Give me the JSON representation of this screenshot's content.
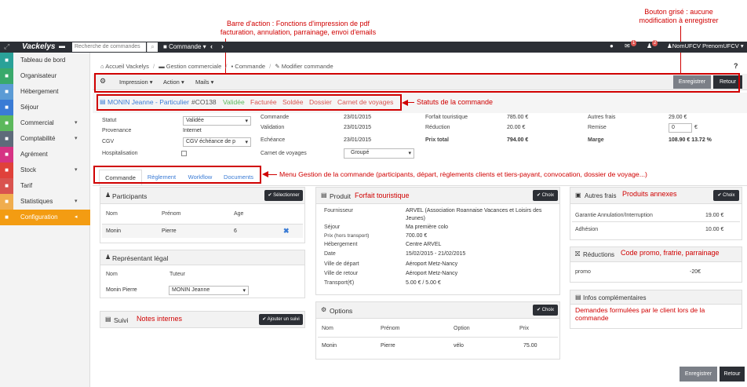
{
  "annotations": {
    "action_bar": [
      "Barre d'action : Fonctions d'impression de pdf",
      "facturation, annulation, parrainage, envoi d'emails"
    ],
    "grey_button": [
      "Bouton grisé : aucune",
      "modification à enregistrer"
    ],
    "statuses": "Statuts de la commande",
    "menu": "Menu Gestion de la commande (participants, départ, règlements clients et tiers-payant, convocation, dossier de voyage...)",
    "forfait": "Forfait touristique",
    "produits": "Produits annexes",
    "reductions": "Code promo, fratrie, parrainage",
    "notes": "Notes internes",
    "demandes": [
      "Demandes formulées par le client lors de la",
      "commande"
    ]
  },
  "topbar": {
    "logo": "Vackelys",
    "search_placeholder": "Recherche de commandes",
    "command": "Commande",
    "user": "NomUFCV PrenomUFCV",
    "badge_mail": "1",
    "badge_user": "2"
  },
  "sidebar": {
    "items": [
      {
        "label": "Tableau de bord",
        "color": "#2aa198"
      },
      {
        "label": "Organisateur",
        "color": "#39a96b"
      },
      {
        "label": "Hébergement",
        "color": "#5b9bd5"
      },
      {
        "label": "Séjour",
        "color": "#3a7bd5"
      },
      {
        "label": "Commercial",
        "color": "#5cb85c",
        "caret": "▾"
      },
      {
        "label": "Comptabilité",
        "color": "#5e6b7a",
        "caret": "▾"
      },
      {
        "label": "Agrément",
        "color": "#d63384"
      },
      {
        "label": "Stock",
        "color": "#e0413a",
        "caret": "▾"
      },
      {
        "label": "Tarif",
        "color": "#d9534f"
      },
      {
        "label": "Statistiques",
        "color": "#f0ad4e",
        "caret": "▾"
      },
      {
        "label": "Configuration",
        "color": "#f39c12",
        "caret": "◂",
        "active": true
      }
    ]
  },
  "breadcrumb": {
    "home": "Accueil Vackelys",
    "sep1": "/",
    "commercial": "Gestion commerciale",
    "sep2": "/",
    "commande": "Commande",
    "sep3": "/",
    "current": "Modifier commande"
  },
  "toolbar": {
    "impression": "Impression",
    "action": "Action",
    "mails": "Mails",
    "save": "Enregistrer",
    "back": "Retour"
  },
  "status_bar": {
    "client": "MONIN Jeanne",
    "type": "- Particulier",
    "code": "#CO138",
    "s1": "Validée",
    "s2": "Facturée",
    "s3": "Soldée",
    "s4": "Dossier",
    "s5": "Carnet de voyages"
  },
  "info": {
    "statut_label": "Statut",
    "statut_value": "Validée",
    "provenance_label": "Provenance",
    "provenance_value": "Internet",
    "cgv_label": "CGV",
    "cgv_value": "CGV échéance de p",
    "hosp_label": "Hospitalisation",
    "commande_label": "Commande",
    "commande_date": "23/01/2015",
    "validation_label": "Validation",
    "validation_date": "23/01/2015",
    "echeance_label": "Echéance",
    "echeance_date": "23/01/2015",
    "carnet_label": "Carnet de voyages",
    "carnet_value": "Groupé",
    "forfait_label": "Forfait touristique",
    "forfait_value": "785.00 €",
    "reduction_label": "Réduction",
    "reduction_value": "20.00 €",
    "prix_label": "Prix total",
    "prix_value": "794.00 €",
    "autres_label": "Autres frais",
    "autres_value": "29.00 €",
    "remise_label": "Remise",
    "remise_value": "0",
    "remise_unit": "€",
    "marge_label": "Marge",
    "marge_value": "108.90 € 13.72 %"
  },
  "tabs": [
    "Commande",
    "Règlement",
    "Workflow",
    "Documents"
  ],
  "participants": {
    "title": "Participants",
    "button": "Sélectionner",
    "headers": [
      "Nom",
      "Prénom",
      "Age"
    ],
    "row": [
      "Monin",
      "Pierre",
      "6"
    ]
  },
  "representant": {
    "title": "Représentant légal",
    "headers": [
      "Nom",
      "Tuteur"
    ],
    "row_name": "Monin Pierre",
    "tuteur": "MONIN Jeanne"
  },
  "suivi": {
    "title": "Suivi",
    "button": "Ajouter un suivi"
  },
  "produit": {
    "title": "Produit",
    "button": "Choix",
    "rows": [
      {
        "label": "Fournisseur",
        "value": "ARVEL (Association Roannaise Vacances et Loisirs des"
      },
      {
        "label": "",
        "value": "Jeunes)"
      },
      {
        "label": "Séjour",
        "value": "Ma première colo"
      },
      {
        "label": "Prix (hors transport)",
        "value": "700.00 €"
      },
      {
        "label": "Hébergement",
        "value": "Centre ARVEL"
      },
      {
        "label": "Date",
        "value": "15/02/2015 - 21/02/2015"
      },
      {
        "label": "Ville de départ",
        "value": "Aéroport Metz-Nancy"
      },
      {
        "label": "Ville de retour",
        "value": "Aéroport Metz-Nancy"
      },
      {
        "label": "Transport(€)",
        "value": "5.00 €  /  5.00 €"
      }
    ]
  },
  "options": {
    "title": "Options",
    "button": "Choix",
    "headers": [
      "Nom",
      "Prénom",
      "Option",
      "Prix"
    ],
    "row": [
      "Monin",
      "Pierre",
      "vélo",
      "75.00"
    ]
  },
  "autres": {
    "title": "Autres frais",
    "button": "Choix",
    "rows": [
      {
        "label": "Garantie Annulation/Interruption",
        "value": "19.00 €"
      },
      {
        "label": "Adhésion",
        "value": "10.00 €"
      }
    ]
  },
  "reductions": {
    "title": "Réductions",
    "row": {
      "label": "promo",
      "value": "-20€"
    }
  },
  "infos": {
    "title": "Infos complémentaires"
  },
  "footer": {
    "save": "Enregistrer",
    "back": "Retour"
  }
}
